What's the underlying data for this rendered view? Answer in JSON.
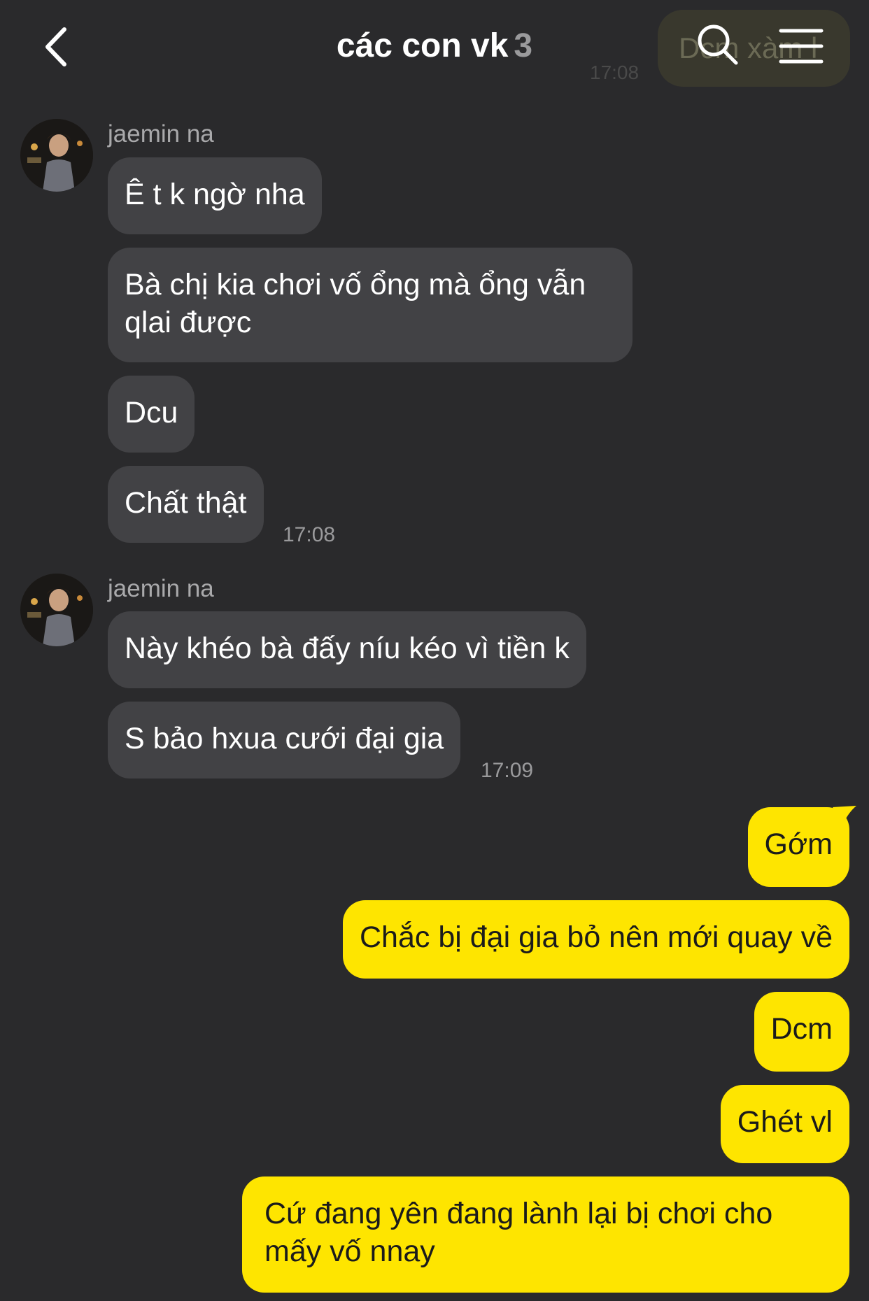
{
  "header": {
    "title": "các con vk",
    "member_count": "3",
    "ghost_text": "Dcm xàm l",
    "ghost_time": "17:08"
  },
  "groups": [
    {
      "sender": "jaemin na",
      "messages": [
        "Ê t k ngờ nha",
        "Bà chị kia chơi vố ổng mà ổng vẫn qlai được",
        "Dcu",
        "Chất thật"
      ],
      "time": "17:08"
    },
    {
      "sender": "jaemin na",
      "messages": [
        "Này khéo bà đấy níu kéo vì tiền k",
        "S bảo hxua cưới đại gia"
      ],
      "time": "17:09"
    }
  ],
  "my_messages": [
    "Gớm",
    "Chắc bị đại gia bỏ nên mới quay về",
    "Dcm",
    "Ghét vl",
    "Cứ đang yên đang lành lại bị chơi cho mấy vố nnay"
  ],
  "colors": {
    "background": "#2a2a2c",
    "incoming_bubble": "#424245",
    "outgoing_bubble": "#fee500",
    "muted_text": "#9a9a9c"
  },
  "icons": [
    "back-arrow-icon",
    "search-icon",
    "menu-icon"
  ]
}
